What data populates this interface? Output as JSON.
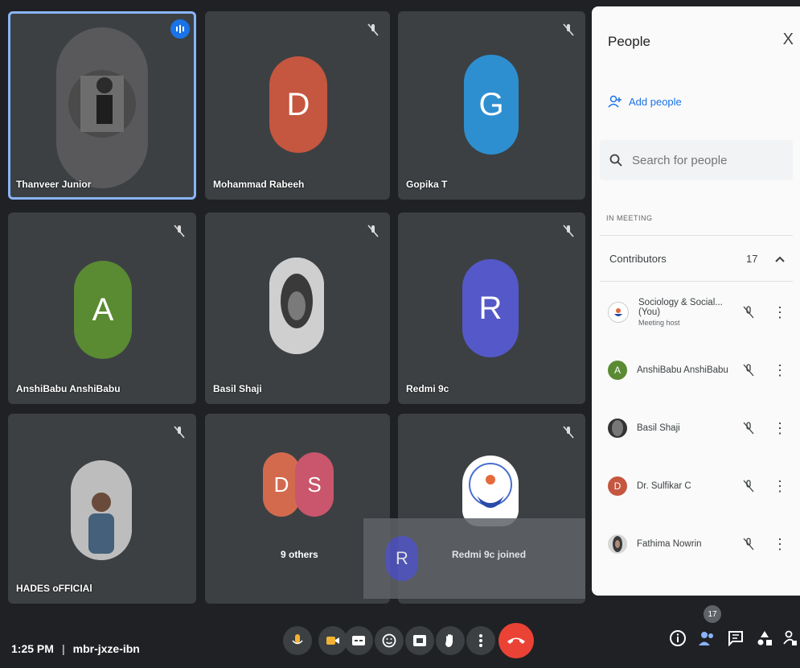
{
  "tiles": [
    {
      "name": "Thanveer Junior",
      "type": "photo",
      "speaking": true
    },
    {
      "name": "Mohammad Rabeeh",
      "initial": "D",
      "color": "#c5563f"
    },
    {
      "name": "Gopika T",
      "initial": "G",
      "color": "#2d8fd0"
    },
    {
      "name": "AnshiBabu AnshiBabu",
      "initial": "A",
      "color": "#5a8a32"
    },
    {
      "name": "Basil Shaji",
      "type": "photo"
    },
    {
      "name": "Redmi 9c",
      "initial": "R",
      "color": "#5458c8"
    },
    {
      "name": "HADES oFFICIAl",
      "type": "photo"
    },
    {
      "name": "9 others",
      "initials": [
        "D",
        "S"
      ],
      "colors": [
        "#d36a4e",
        "#c9566c"
      ]
    },
    {
      "name": "",
      "type": "logo"
    }
  ],
  "toast": {
    "initial": "R",
    "text": "Redmi 9c joined",
    "color": "#5458c8"
  },
  "panel": {
    "title": "People",
    "close": "X",
    "add_people": "Add people",
    "search_placeholder": "Search for people",
    "section": "IN MEETING",
    "contributors_label": "Contributors",
    "contributors_count": "17",
    "people": [
      {
        "name": "Sociology & Social... (You)",
        "sub": "Meeting host",
        "type": "logo"
      },
      {
        "name": "AnshiBabu AnshiBabu",
        "initial": "A",
        "color": "#5a8a32"
      },
      {
        "name": "Basil Shaji",
        "type": "photo"
      },
      {
        "name": "Dr. Sulfikar C",
        "initial": "D",
        "color": "#c5563f"
      },
      {
        "name": "Fathima Nowrin",
        "type": "photo"
      }
    ]
  },
  "bottom": {
    "time": "1:25 PM",
    "meeting_code": "mbr-jxze-ibn",
    "people_badge": "17"
  }
}
